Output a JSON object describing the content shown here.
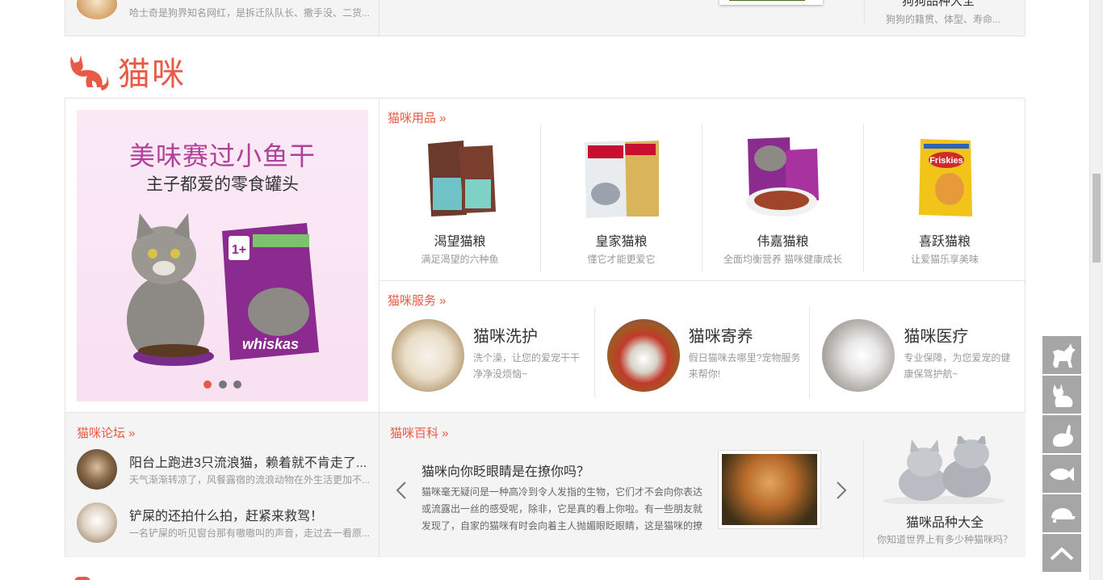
{
  "top_strip": {
    "snippet": "哈士奇是狗界知名网红，是拆迁队队长、撒手没、二货...",
    "right_title": "狗狗品种大全",
    "right_desc": "狗狗的籍贯、体型、寿命..."
  },
  "section": {
    "title": "猫咪"
  },
  "banner": {
    "title": "美味赛过小鱼干",
    "subtitle": "主子都爱的零食罐头",
    "slides": 3,
    "active_slide": 1
  },
  "supplies": {
    "heading": "猫咪用品 »",
    "products": [
      {
        "name": "渴望猫粮",
        "desc": "满足渴望的六种鱼",
        "icon": "orijen-bag-icon"
      },
      {
        "name": "皇家猫粮",
        "desc": "懂它才能更爱它",
        "icon": "royal-canin-bag-icon"
      },
      {
        "name": "伟嘉猫粮",
        "desc": "全面均衡营养 猫咪健康成长",
        "icon": "whiskas-pouch-icon"
      },
      {
        "name": "喜跃猫粮",
        "desc": "让爱猫乐享美味",
        "icon": "friskies-bag-icon"
      }
    ]
  },
  "services": {
    "heading": "猫咪服务 »",
    "items": [
      {
        "name": "猫咪洗护",
        "desc": "洗个澡，让您的爱宠干干净净没烦恼~"
      },
      {
        "name": "猫咪寄养",
        "desc": "假日猫咪去哪里?宠物服务来帮你!"
      },
      {
        "name": "猫咪医疗",
        "desc": "专业保障，为您爱宠的健康保驾护航~"
      }
    ]
  },
  "forum": {
    "heading": "猫咪论坛 »",
    "items": [
      {
        "title": "阳台上跑进3只流浪猫，赖着就不肯走了...",
        "desc": "天气渐渐转凉了，风餐露宿的流浪动物在外生活更加不..."
      },
      {
        "title": "铲屎的还拍什么拍，赶紧来救驾！",
        "desc": "一名铲屎的听见窗台那有嗷嗷叫的声音，走过去一看原..."
      }
    ]
  },
  "wiki": {
    "heading": "猫咪百科 »",
    "article_title": "猫咪向你眨眼睛是在撩你吗？",
    "article_text": "猫咪毫无疑问是一种高冷到令人发指的生物，它们才不会向你表达或流露出一丝的感受呢，除非，它是真的看上你啦。有一些朋友就发现了，自家的猫咪有时会向着主人抛媚眼眨眼睛，这是猫咪的撩",
    "breed_title": "猫咪品种大全",
    "breed_desc": "你知道世界上有多少种猫咪吗？"
  },
  "side_tools": [
    "dog-icon",
    "cat-icon",
    "rabbit-icon",
    "fish-icon",
    "turtle-icon",
    "back-to-top-icon"
  ],
  "colors": {
    "accent": "#e85a45",
    "tool_bg": "#a6a6a6",
    "panel_bg": "#f4f4f4"
  }
}
